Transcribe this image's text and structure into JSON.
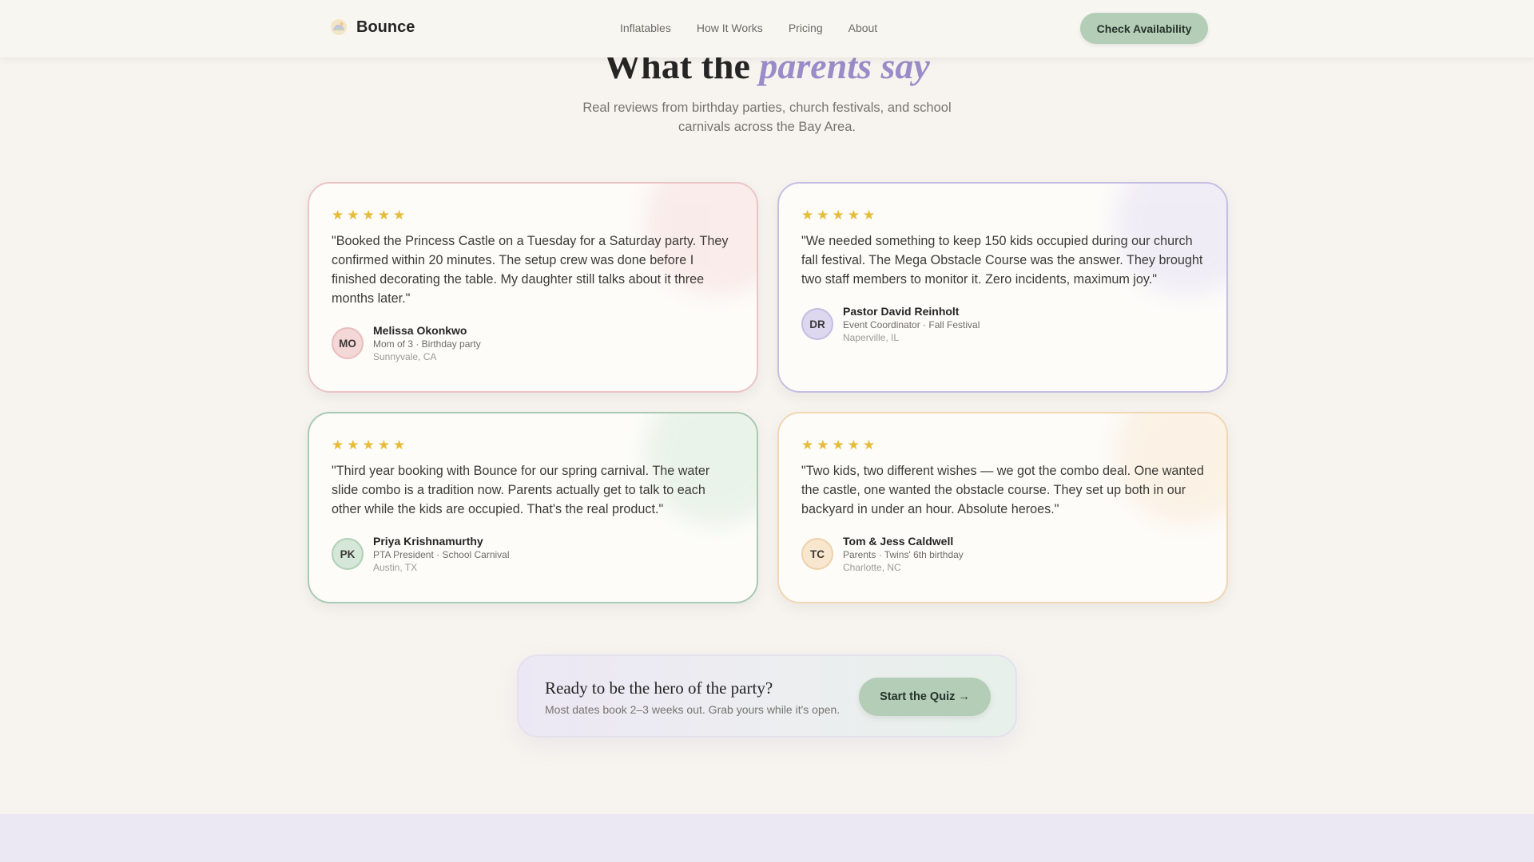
{
  "header": {
    "brand": "Bounce",
    "nav": [
      "Inflatables",
      "How It Works",
      "Pricing",
      "About"
    ],
    "cta_label": "Check Availability"
  },
  "section": {
    "title_lead": "What the",
    "title_accent": "parents say",
    "subtitle_line1": "Real reviews from birthday parties, church festivals, and school",
    "subtitle_line2": "carnivals across the Bay Area."
  },
  "reviews": [
    {
      "stars": 5,
      "quote": "\"Booked the Princess Castle on a Tuesday for a Saturday party. They confirmed within 20 minutes. The setup crew was done before I finished decorating the table. My daughter still talks about it three months later.\"",
      "initials": "MO",
      "name": "Melissa Okonkwo",
      "role": "Mom of 3 · Birthday party",
      "location": "Sunnyvale, CA",
      "accent": "#ebc4c6"
    },
    {
      "stars": 5,
      "quote": "\"We needed something to keep 150 kids occupied during our church fall festival. The Mega Obstacle Course was the answer. They brought two staff members to monitor it. Zero incidents, maximum joy.\"",
      "initials": "DR",
      "name": "Pastor David Reinholt",
      "role": "Event Coordinator · Fall Festival",
      "location": "Naperville, IL",
      "accent": "#c4bfe2"
    },
    {
      "stars": 5,
      "quote": "\"Third year booking with Bounce for our spring carnival. The water slide combo is a tradition now. Parents actually get to talk to each other while the kids are occupied. That's the real product.\"",
      "initials": "PK",
      "name": "Priya Krishnamurthy",
      "role": "PTA President · School Carnival",
      "location": "Austin, TX",
      "accent": "#a9c9b3"
    },
    {
      "stars": 5,
      "quote": "\"Two kids, two different wishes — we got the combo deal. One wanted the castle, one wanted the obstacle course. They set up both in our backyard in under an hour. Absolute heroes.\"",
      "initials": "TC",
      "name": "Tom & Jess Caldwell",
      "role": "Parents · Twins' 6th birthday",
      "location": "Charlotte, NC",
      "accent": "#f1d6b2"
    }
  ],
  "cta": {
    "title": "Ready to be the hero of the party?",
    "subtitle": "Most dates book 2–3 weeks out. Grab yours while it's open.",
    "button": "Start the Quiz →"
  },
  "colors": {
    "background": "#f7f4ef",
    "primary_button": "#b4cdb7",
    "star": "#e6bc3b",
    "accent_text": "#9a8cc8"
  },
  "icons": {
    "brand": "bounce-house-logo-icon",
    "star": "star-icon"
  }
}
